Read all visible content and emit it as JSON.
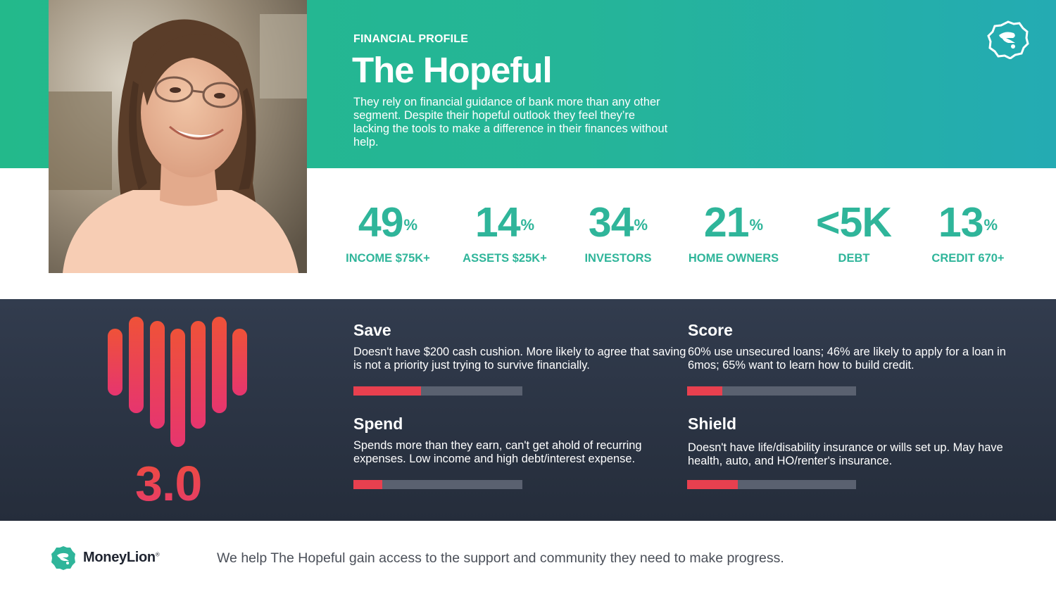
{
  "header": {
    "eyebrow": "FINANCIAL PROFILE",
    "title": "The Hopeful",
    "description": "They rely on financial guidance of bank more than any other segment. Despite their hopeful outlook they feel they’re lacking the tools to make a difference in their finances without help.",
    "brand_icon": "moneylion-badge-icon"
  },
  "photo": {
    "subject": "profile-photo"
  },
  "stats": [
    {
      "value": "49",
      "suffix": "%",
      "label": "INCOME $75K+"
    },
    {
      "value": "14",
      "suffix": "%",
      "label": "ASSETS $25K+"
    },
    {
      "value": "34",
      "suffix": "%",
      "label": "INVESTORS"
    },
    {
      "value": "21",
      "suffix": "%",
      "label": "HOME OWNERS"
    },
    {
      "value": "<5K",
      "suffix": "",
      "label": "DEBT"
    },
    {
      "value": "13",
      "suffix": "%",
      "label": "CREDIT 670+"
    }
  ],
  "score": {
    "value": "3.0",
    "icon": "health-heart-bars-icon"
  },
  "categories": [
    {
      "title": "Save",
      "text": "Doesn't have $200 cash cushion. More likely to agree that saving is not a priority just trying to survive financially.",
      "level": 0.4
    },
    {
      "title": "Score",
      "text": "60% use unsecured loans; 46% are likely to apply for a loan in 6mos; 65% want to learn how to build credit.",
      "level": 0.21
    },
    {
      "title": "Spend",
      "text": "Spends more than they earn, can't get ahold of recurring expenses. Low income and high debt/interest expense.",
      "level": 0.17
    },
    {
      "title": "Shield",
      "text": "Doesn't have life/disability insurance or wills set up. May have health, auto, and HO/renter's insurance.",
      "level": 0.3
    }
  ],
  "footer": {
    "brand": "MoneyLion",
    "brand_mark": "®",
    "tagline": "We help The Hopeful gain access to the support and community they need to make progress."
  },
  "colors": {
    "accent_green": "#2fb59a",
    "score_red": "#e8404f",
    "dark_panel": "#2b3444"
  }
}
